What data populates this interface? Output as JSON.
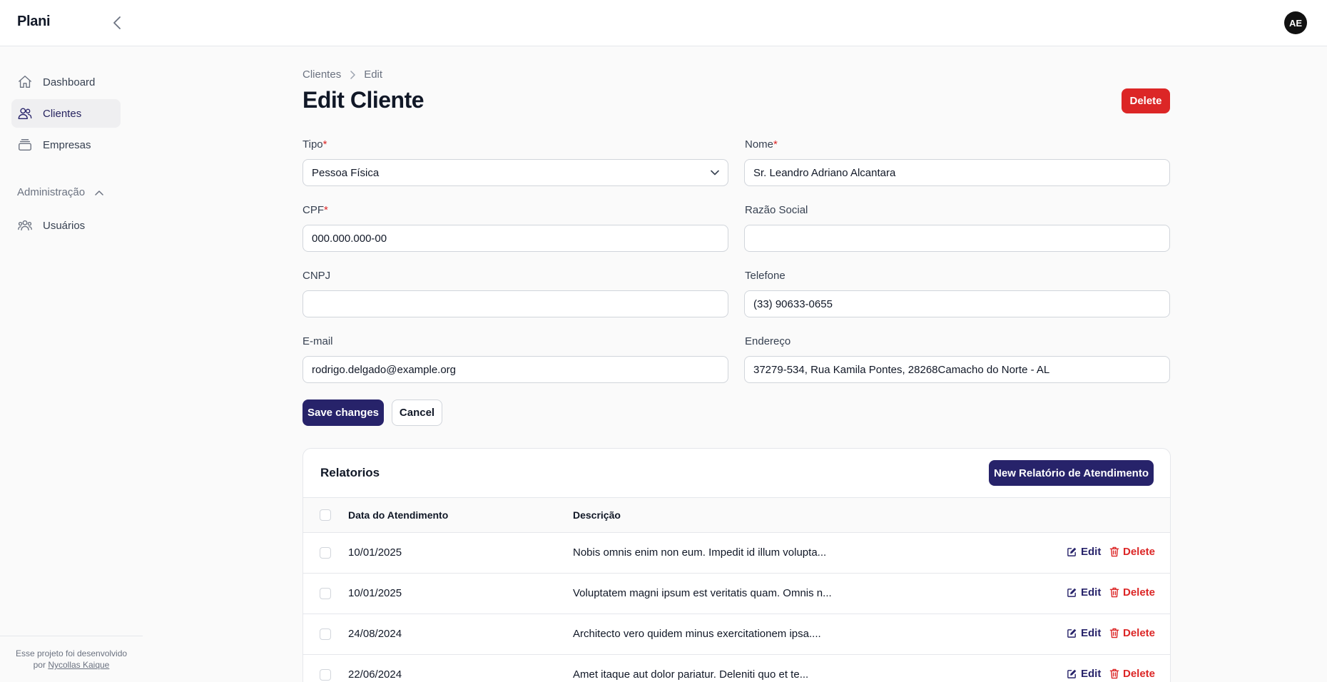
{
  "app": {
    "brand": "Plani",
    "avatar_initials": "AE"
  },
  "sidebar": {
    "items": [
      {
        "label": "Dashboard",
        "icon": "home-icon"
      },
      {
        "label": "Clientes",
        "icon": "users-icon",
        "active": true
      },
      {
        "label": "Empresas",
        "icon": "stack-icon"
      }
    ],
    "group": {
      "label": "Administração",
      "items": [
        {
          "label": "Usuários",
          "icon": "user-group-icon"
        }
      ]
    },
    "footer": {
      "line1": "Esse projeto foi desenvolvido",
      "prefix": "por",
      "author": "Nycollas Kaique"
    }
  },
  "breadcrumb": {
    "parent": "Clientes",
    "current": "Edit"
  },
  "page": {
    "title": "Edit Cliente",
    "delete_label": "Delete"
  },
  "form": {
    "tipo": {
      "label": "Tipo",
      "required": "*",
      "value": "Pessoa Física"
    },
    "nome": {
      "label": "Nome",
      "required": "*",
      "value": "Sr. Leandro Adriano Alcantara"
    },
    "cpf": {
      "label": "CPF",
      "required": "*",
      "value": "000.000.000-00"
    },
    "razao_social": {
      "label": "Razão Social",
      "value": ""
    },
    "cnpj": {
      "label": "CNPJ",
      "value": ""
    },
    "telefone": {
      "label": "Telefone",
      "value": "(33) 90633-0655"
    },
    "email": {
      "label": "E-mail",
      "value": "rodrigo.delgado@example.org"
    },
    "endereco": {
      "label": "Endereço",
      "value": "37279-534, Rua Kamila Pontes, 28268Camacho do Norte - AL"
    },
    "save_label": "Save changes",
    "cancel_label": "Cancel"
  },
  "relatorios": {
    "title": "Relatorios",
    "new_label": "New Relatório de Atendimento",
    "columns": [
      "Data do Atendimento",
      "Descrição"
    ],
    "edit_label": "Edit",
    "delete_label": "Delete",
    "rows": [
      {
        "date": "10/01/2025",
        "description": "Nobis omnis enim non eum. Impedit id illum volupta..."
      },
      {
        "date": "10/01/2025",
        "description": "Voluptatem magni ipsum est veritatis quam. Omnis n..."
      },
      {
        "date": "24/08/2024",
        "description": "Architecto vero quidem minus exercitationem ipsa...."
      },
      {
        "date": "22/06/2024",
        "description": "Amet itaque aut dolor pariatur. Deleniti quo et te..."
      }
    ]
  },
  "colors": {
    "primary": "#27236a",
    "danger": "#dc2626",
    "background": "#fafafa"
  }
}
